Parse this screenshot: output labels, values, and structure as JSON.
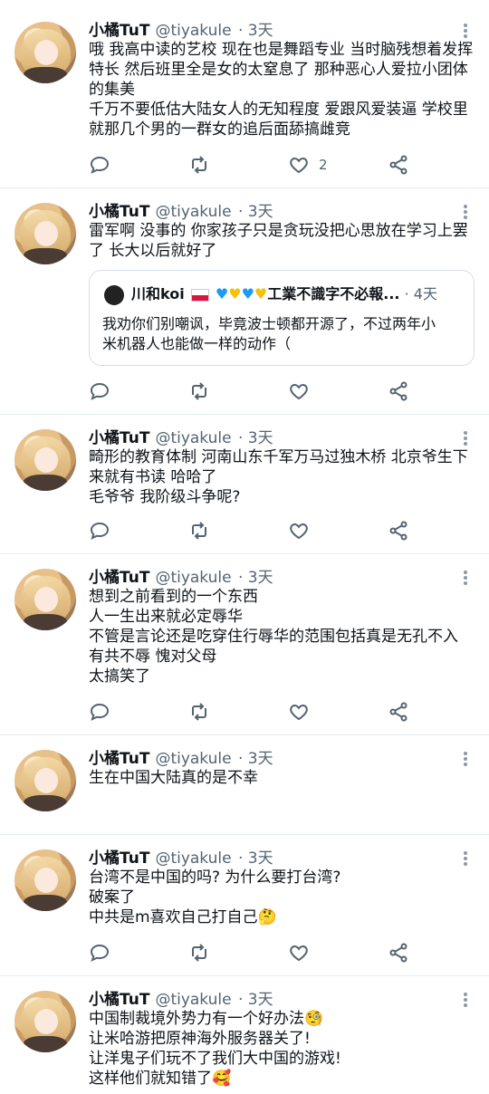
{
  "tweets": [
    {
      "name": "小橘TuT",
      "handle": "@tiyakule",
      "time": "· 3天",
      "lines": [
        "哦 我高中读的艺校 现在也是舞蹈专业 当时脑残想着发挥",
        "特长 然后班里全是女的太窒息了 那种恶心人爱拉小团体",
        "的集美",
        "千万不要低估大陆女人的无知程度 爱跟风爱装逼 学校里",
        "就那几个男的一群女的追后面舔搞雌竞"
      ],
      "like_count": "2"
    },
    {
      "name": "小橘TuT",
      "handle": "@tiyakule",
      "time": "· 3天",
      "lines": [
        "雷军啊 没事的 你家孩子只是贪玩没把心思放在学习上罢",
        "了 长大以后就好了"
      ],
      "quote": {
        "name": "川和koi",
        "after_flag": "工業不識字不必報...",
        "time": "· 4天",
        "lines": [
          "我劝你们别嘲讽，毕竟波士顿都开源了，不过两年小",
          "米机器人也能做一样的动作（"
        ]
      }
    },
    {
      "name": "小橘TuT",
      "handle": "@tiyakule",
      "time": "· 3天",
      "lines": [
        "畸形的教育体制 河南山东千军万马过独木桥 北京爷生下",
        "来就有书读 哈哈了",
        "毛爷爷 我阶级斗争呢?"
      ]
    },
    {
      "name": "小橘TuT",
      "handle": "@tiyakule",
      "time": "· 3天",
      "lines": [
        "想到之前看到的一个东西",
        "人一生出来就必定辱华",
        "不管是言论还是吃穿住行辱华的范围包括真是无孔不入",
        "有共不辱 愧对父母",
        "太搞笑了"
      ]
    },
    {
      "name": "小橘TuT",
      "handle": "@tiyakule",
      "time": "· 3天",
      "lines": [
        "生在中国大陆真的是不幸"
      ]
    },
    {
      "name": "小橘TuT",
      "handle": "@tiyakule",
      "time": "· 3天",
      "lines": [
        "台湾不是中国的吗? 为什么要打台湾?",
        "破案了",
        "中共是m喜欢自己打自己🤔"
      ]
    },
    {
      "name": "小橘TuT",
      "handle": "@tiyakule",
      "time": "· 3天",
      "lines": [
        "中国制裁境外势力有一个好办法🧐",
        "让米哈游把原神海外服务器关了!",
        "让洋鬼子们玩不了我们大中国的游戏!",
        "这样他们就知错了🥰"
      ]
    }
  ],
  "icons": {
    "reply": "reply-icon",
    "retweet": "retweet-icon",
    "like": "heart-icon",
    "share": "share-icon",
    "more": "more-icon"
  },
  "colors": {
    "muted": "#536471",
    "icon": "#536471",
    "divider": "#e6ecf0"
  }
}
